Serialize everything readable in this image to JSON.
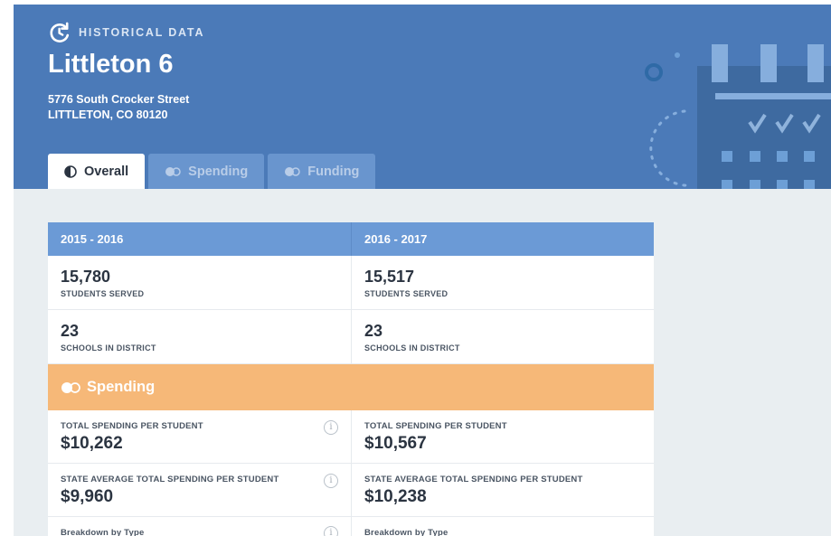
{
  "header": {
    "section_label": "HISTORICAL DATA",
    "section_icon": "history-icon",
    "district_name": "Littleton 6",
    "address_line1": "5776 South Crocker Street",
    "address_line2": "LITTLETON, CO 80120",
    "decoration_icon": "calendar-icon"
  },
  "tabs": [
    {
      "label": "Overall",
      "icon": "pie-icon",
      "active": true
    },
    {
      "label": "Spending",
      "icon": "coins-icon",
      "active": false
    },
    {
      "label": "Funding",
      "icon": "coins-icon",
      "active": false
    }
  ],
  "table": {
    "years": [
      "2015 - 2016",
      "2016 - 2017"
    ],
    "students_served": {
      "label": "STUDENTS SERVED",
      "values": [
        "15,780",
        "15,517"
      ]
    },
    "schools_in_district": {
      "label": "SCHOOLS IN DISTRICT",
      "values": [
        "23",
        "23"
      ]
    },
    "spending_section": {
      "label": "Spending",
      "icon": "coins-icon"
    },
    "total_spending_per_student": {
      "label": "TOTAL SPENDING PER STUDENT",
      "values": [
        "$10,262",
        "$10,567"
      ]
    },
    "state_average_total_spending": {
      "label": "STATE AVERAGE TOTAL SPENDING PER STUDENT",
      "values": [
        "$9,960",
        "$10,238"
      ]
    },
    "breakdown_by_type": {
      "label": "Breakdown by Type"
    },
    "info_glyph": "i"
  },
  "colors": {
    "header_blue": "#4b7ab8",
    "table_header_blue": "#6b9ad6",
    "spending_orange": "#f6b878",
    "page_background": "#e9eef1"
  }
}
